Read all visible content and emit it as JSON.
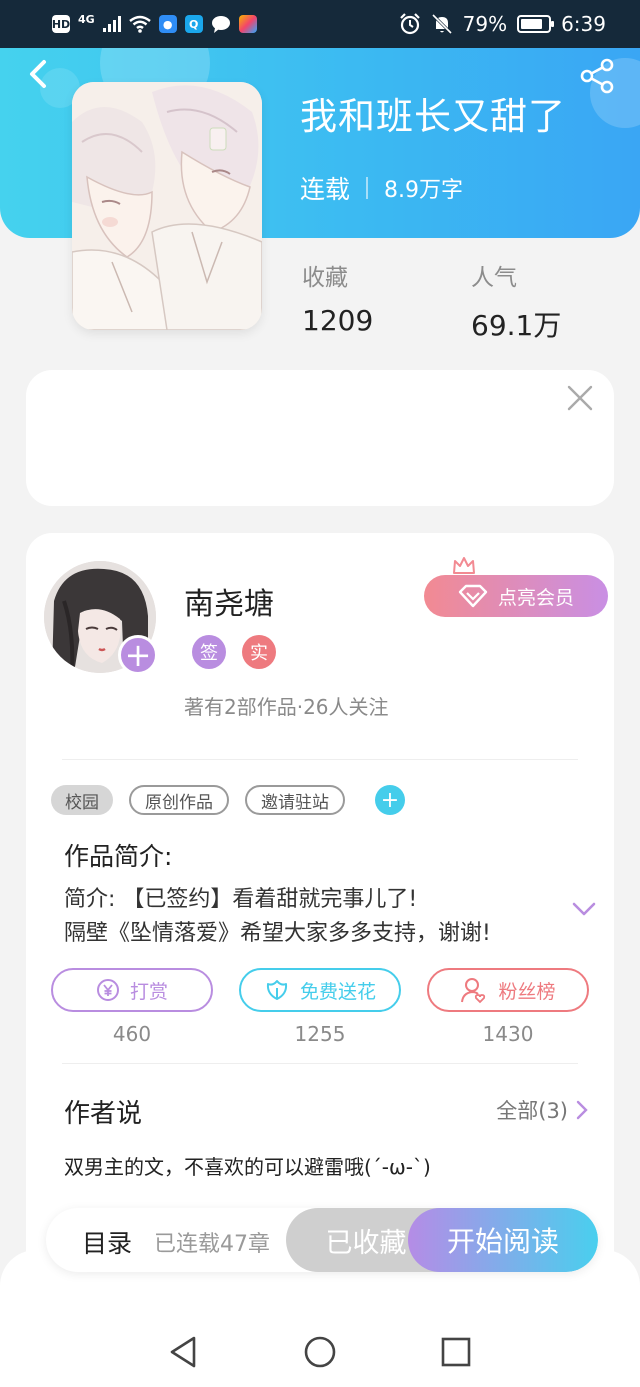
{
  "status_bar": {
    "network": "HD",
    "signal_label": "4G",
    "battery": "79%",
    "battery_level": 0.79,
    "time": "6:39",
    "icons": [
      "wifi-icon",
      "bulb-app-icon",
      "search-app-icon",
      "message-app-icon",
      "gallery-app-icon",
      "alarm-icon",
      "mute-icon"
    ]
  },
  "header": {
    "title": "我和班长又甜了",
    "status": "连载",
    "word_count": "8.9万字",
    "back_icon": "chevron-left-icon",
    "share_icon": "share-icon"
  },
  "stats": {
    "favorites_label": "收藏",
    "favorites_value": "1209",
    "popularity_label": "人气",
    "popularity_value": "69.1万"
  },
  "author": {
    "name": "南尧塘",
    "badges": [
      {
        "text": "签",
        "color": "#b98de0"
      },
      {
        "text": "实",
        "color": "#ee7a7f"
      }
    ],
    "info": "著有2部作品·26人关注",
    "vip_label": "点亮会员"
  },
  "tags": {
    "items": [
      "校园",
      "原创作品",
      "邀请驻站"
    ]
  },
  "intro": {
    "heading": "作品简介:",
    "line1": "简介: 【已签约】看着甜就完事儿了!",
    "line2": "隔壁《坠情落爱》希望大家多多支持，谢谢!"
  },
  "actions": [
    {
      "label": "打赏",
      "count": "460",
      "color": "#b98de0",
      "icon": "yen-coin-icon"
    },
    {
      "label": "免费送花",
      "count": "1255",
      "color": "#45cdeb",
      "icon": "flower-icon"
    },
    {
      "label": "粉丝榜",
      "count": "1430",
      "color": "#ee7a7f",
      "icon": "user-heart-icon"
    }
  ],
  "author_said": {
    "heading": "作者说",
    "all_label": "全部(3)",
    "text": "双男主的文，不喜欢的可以避雷哦(´-ω-`)"
  },
  "bottom_bar": {
    "toc": "目录",
    "chapters": "已连载47章",
    "collected": "已收藏",
    "read": "开始阅读"
  },
  "nav": {
    "icons": [
      "back-triangle-icon",
      "home-circle-icon",
      "recents-square-icon"
    ]
  },
  "colors": {
    "header_start": "#45d2ee",
    "header_end": "#3aa6f4",
    "accent_purple": "#b98de0",
    "accent_cyan": "#45cdeb",
    "accent_red": "#ee7a7f"
  }
}
